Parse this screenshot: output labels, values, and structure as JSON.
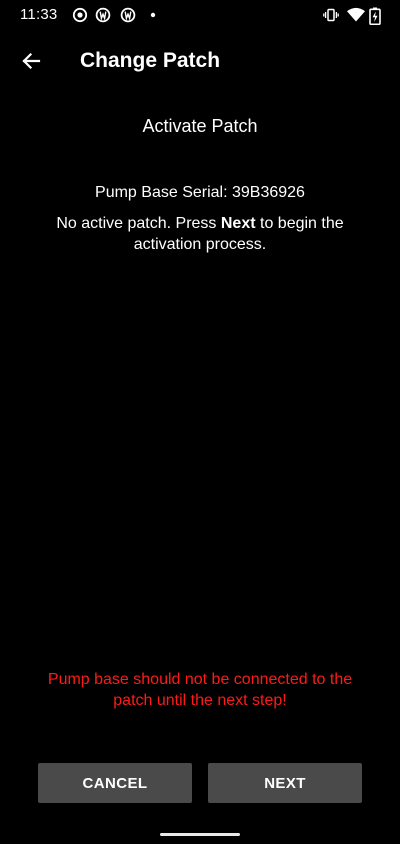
{
  "status_bar": {
    "time": "11:33",
    "left_icons": [
      "record-icon",
      "app-notification-icon",
      "app-notification-icon",
      "dot-icon"
    ],
    "right_icons": [
      "vibrate-icon",
      "wifi-icon",
      "battery-charging-icon"
    ]
  },
  "app_bar": {
    "back_icon": "arrow-left-icon",
    "title": "Change Patch"
  },
  "content": {
    "step_title": "Activate Patch",
    "serial_line": "Pump Base Serial: 39B36926",
    "instruction_prefix": "No active patch. Press ",
    "instruction_bold": "Next",
    "instruction_suffix": " to begin the activation process.",
    "warning": "Pump base should not be connected to the patch until the next step!"
  },
  "buttons": {
    "cancel_label": "CANCEL",
    "next_label": "NEXT"
  },
  "colors": {
    "background": "#000000",
    "text": "#ffffff",
    "warning": "#ff1a1a",
    "button": "#4a4a4a"
  }
}
